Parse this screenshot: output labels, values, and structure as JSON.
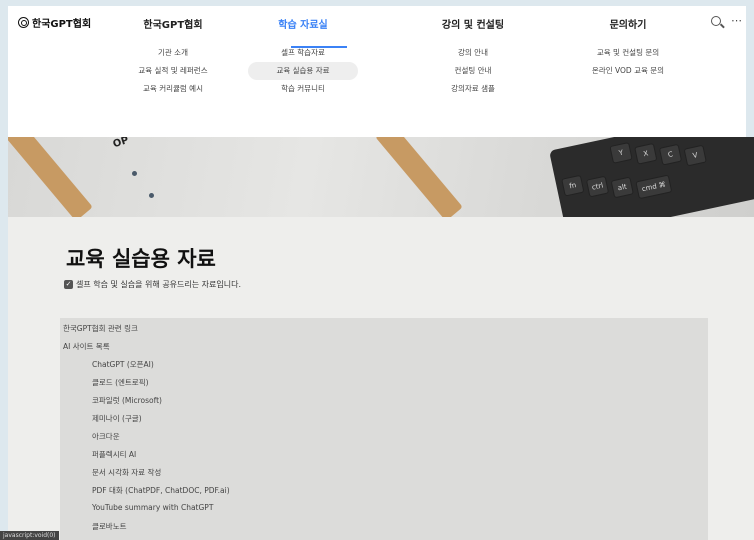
{
  "logo": {
    "label": "한국GPT협회"
  },
  "nav": [
    {
      "label": "한국GPT협회",
      "active": false,
      "subs": [
        "기관 소개",
        "교육 실적 및 레퍼런스",
        "교육 커리큘럼 예시"
      ]
    },
    {
      "label": "학습 자료실",
      "active": true,
      "subs": [
        "셀프 학습자료",
        "교육 실습용 자료",
        "학습 커뮤니티"
      ]
    },
    {
      "label": "강의 및 컨설팅",
      "active": false,
      "subs": [
        "강의 안내",
        "컨설팅 안내",
        "강의자료 샘플"
      ]
    },
    {
      "label": "문의하기",
      "active": false,
      "subs": [
        "교육 및 컨설팅 문의",
        "온라인 VOD 교육 문의"
      ]
    }
  ],
  "icons": {
    "search": "search-icon",
    "more": "⋯"
  },
  "hero": {
    "text": "OP",
    "keys": [
      "Y",
      "X",
      "C",
      "V",
      "fn",
      "ctrl",
      "alt",
      "cmd ⌘"
    ]
  },
  "page": {
    "title": "교육 실습용 자료",
    "subtitle": "셀프 학습 및 실습을 위해 공유드리는 자료입니다."
  },
  "links": [
    {
      "text": "한국GPT협회 관련 링크",
      "level": 0
    },
    {
      "text": "AI 사이트 목록",
      "level": 0
    },
    {
      "text": "ChatGPT (오픈AI)",
      "level": 1
    },
    {
      "text": "클로드 (엔트로픽)",
      "level": 1
    },
    {
      "text": "코파일럿 (Microsoft)",
      "level": 1
    },
    {
      "text": "제미나이 (구글)",
      "level": 1
    },
    {
      "text": "아크다운",
      "level": 1
    },
    {
      "text": "퍼플렉시티 AI",
      "level": 1
    },
    {
      "text": "문서 시각화 자료 작성",
      "level": 1
    },
    {
      "text": "PDF 대화 (ChatPDF, ChatDOC, PDF.ai)",
      "level": 1
    },
    {
      "text": "YouTube summary with ChatGPT",
      "level": 1
    },
    {
      "text": "클로바노트",
      "level": 1
    }
  ],
  "status": "javascript:void(0)"
}
